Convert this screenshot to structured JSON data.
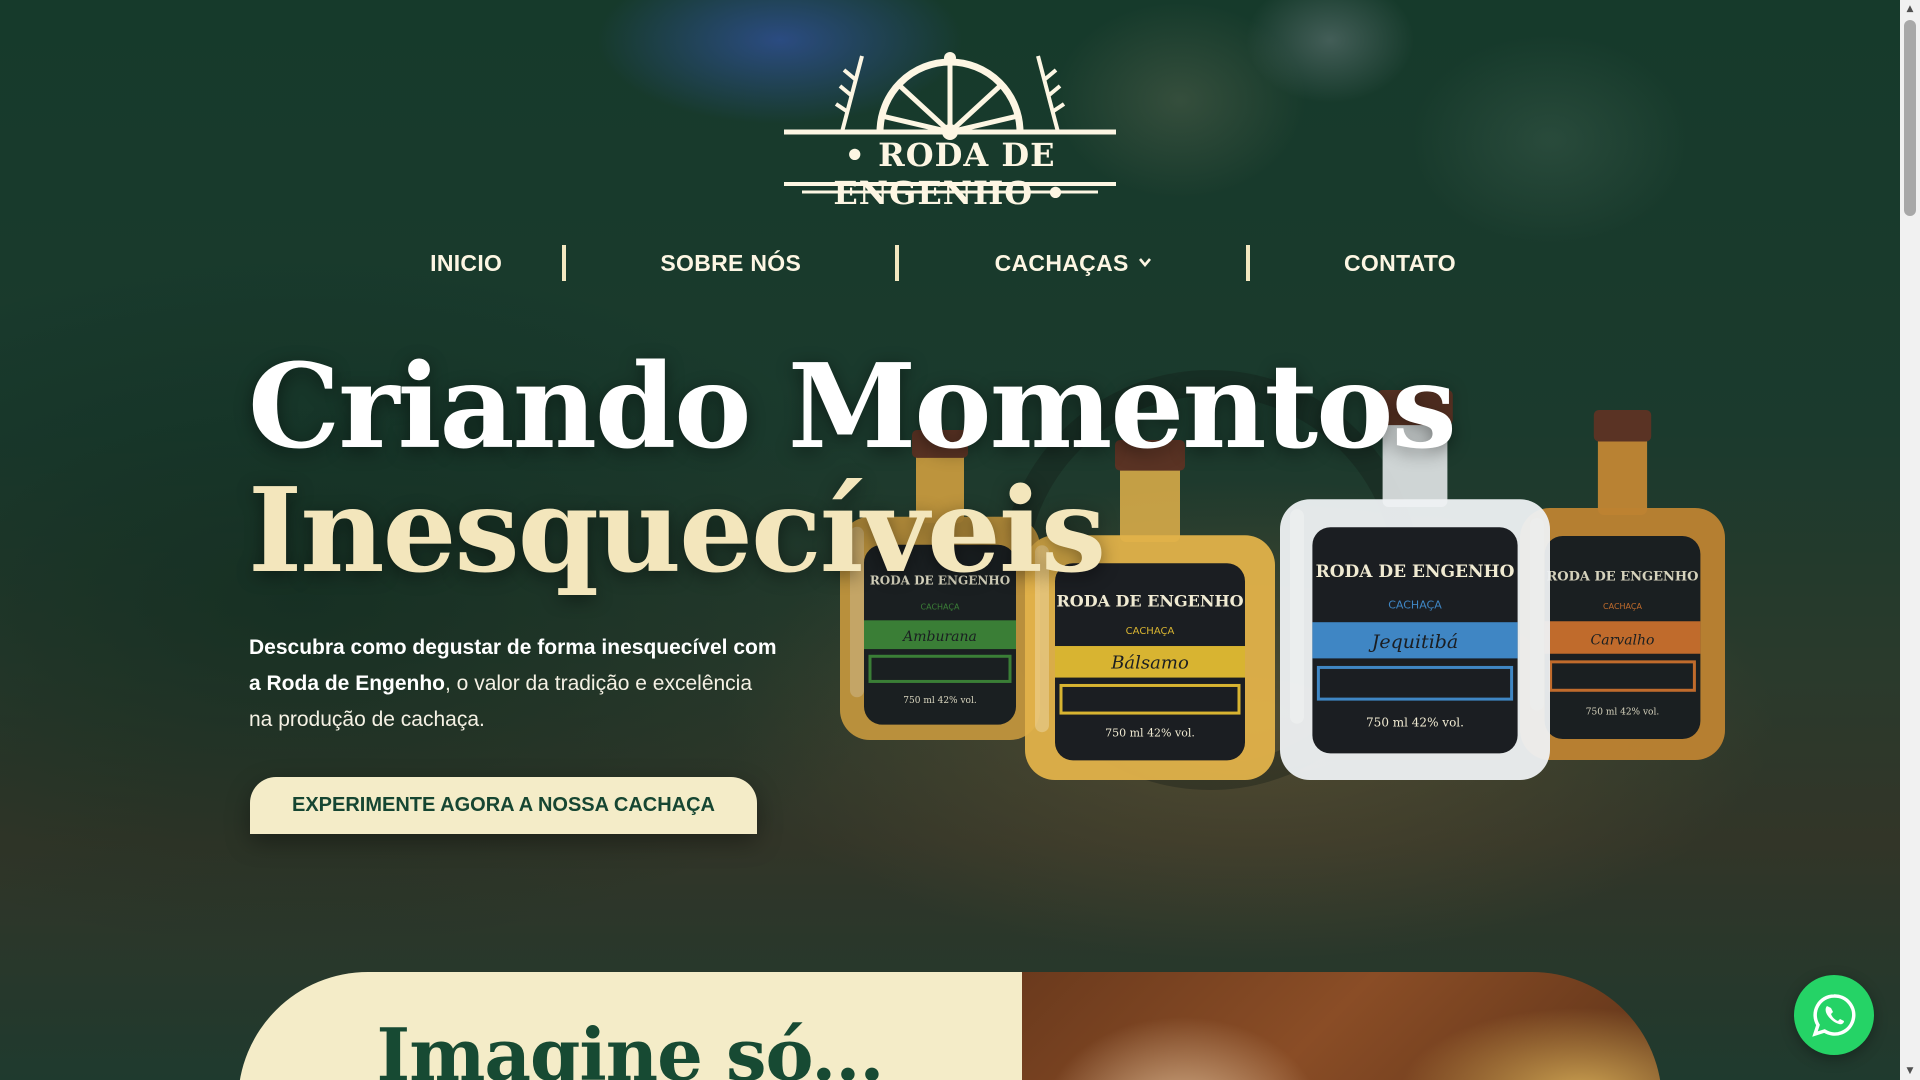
{
  "brand": {
    "logo_text": "• RODA DE ENGENHO •"
  },
  "nav": {
    "items": [
      {
        "label": "INICIO"
      },
      {
        "label": "SOBRE NÓS"
      },
      {
        "label": "CACHAÇAS"
      },
      {
        "label": "CONTATO"
      }
    ]
  },
  "hero": {
    "headline_line1": "Criando Momentos",
    "headline_line2": "Inesquecíveis",
    "description_bold": "Descubra como degustar de forma inesquecível com a Roda de Engenho",
    "description_rest": ", o valor da tradição e excelência na produção de cachaça.",
    "cta_label": "EXPERIMENTE AGORA A NOSSA CACHAÇA"
  },
  "bottles": [
    {
      "brand": "RODA DE ENGENHO",
      "kind": "CACHAÇA",
      "name": "Amburana",
      "volume": "750 ml  42% vol.",
      "color": "#3f8a3a",
      "liquid": "#d9a441"
    },
    {
      "brand": "RODA DE ENGENHO",
      "kind": "CACHAÇA",
      "name": "Bálsamo",
      "volume": "750 ml  42% vol.",
      "color": "#d8b431",
      "liquid": "#e2b24a"
    },
    {
      "brand": "RODA DE ENGENHO",
      "kind": "CACHAÇA",
      "name": "Jequitibá",
      "volume": "750 ml  42% vol.",
      "color": "#3f86c4",
      "liquid": "#eef1f3"
    },
    {
      "brand": "RODA DE ENGENHO",
      "kind": "CACHAÇA",
      "name": "Carvalho",
      "volume": "750 ml  42% vol.",
      "color": "#d8752e",
      "liquid": "#d58f35"
    }
  ],
  "section2": {
    "title": "Imagine só..."
  },
  "colors": {
    "accent_cream": "#f4ecc8",
    "brand_green": "#164632",
    "whatsapp": "#25d366"
  },
  "icons": {
    "whatsapp": "whatsapp-icon",
    "chevron": "chevron-down-icon"
  }
}
